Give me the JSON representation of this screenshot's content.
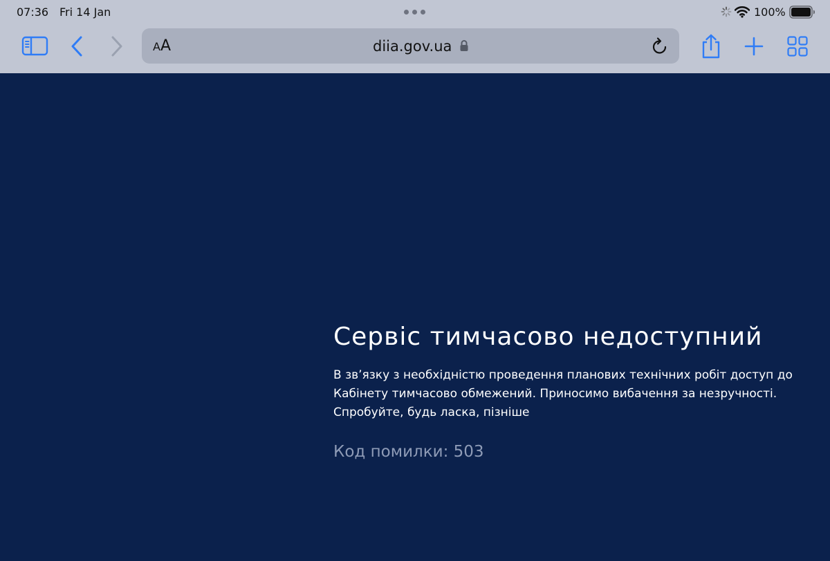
{
  "status_bar": {
    "time": "07:36",
    "date": "Fri 14 Jan",
    "battery_percent": "100%",
    "icons": [
      "activity-spinner-icon",
      "wifi-icon",
      "battery-icon"
    ]
  },
  "toolbar": {
    "reader_small": "A",
    "reader_big": "A",
    "url": "diia.gov.ua",
    "accent_color": "#2f7cf6",
    "disabled_color": "#9aa1b0",
    "icons": [
      "sidebar-icon",
      "back-chevron-icon",
      "forward-chevron-icon",
      "lock-icon",
      "reload-icon",
      "share-icon",
      "plus-icon",
      "tabs-grid-icon"
    ]
  },
  "page": {
    "background_color": "#0b214c",
    "title": "Сервіс тимчасово недоступний",
    "message": "В зв’язку з необхідністю проведення планових технічних робіт доступ до Кабінету тимчасово обмежений. Приносимо вибачення за незручності. Спробуйте, будь ласка, пізніше",
    "error_code": "Код помилки: 503"
  }
}
